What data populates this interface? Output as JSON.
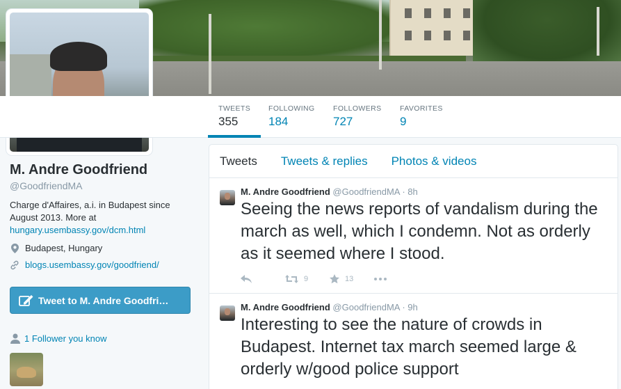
{
  "stats": [
    {
      "label": "TWEETS",
      "value": "355"
    },
    {
      "label": "FOLLOWING",
      "value": "184"
    },
    {
      "label": "FOLLOWERS",
      "value": "727"
    },
    {
      "label": "FAVORITES",
      "value": "9"
    }
  ],
  "profile": {
    "name": "M. Andre Goodfriend",
    "handle": "@GoodfriendMA",
    "bio_text": "Charge d'Affaires, a.i. in Budapest since August 2013. More at",
    "bio_link": "hungary.usembassy.gov/dcm.html",
    "location": "Budapest, Hungary",
    "website": "blogs.usembassy.gov/goodfriend/"
  },
  "tweet_to_button": "Tweet to M. Andre Goodfri…",
  "followers_you_know": "1 Follower you know",
  "timeline_tabs": [
    "Tweets",
    "Tweets & replies",
    "Photos & videos"
  ],
  "tweets": [
    {
      "name": "M. Andre Goodfriend",
      "handle": "@GoodfriendMA",
      "time": "· 8h",
      "text": "Seeing the news reports of vandalism during the march as well, which I condemn.  Not as orderly as it seemed where I stood.",
      "retweets": "9",
      "favorites": "13"
    },
    {
      "name": "M. Andre Goodfriend",
      "handle": "@GoodfriendMA",
      "time": "· 9h",
      "text": "Interesting to see the nature of crowds in Budapest. Internet tax march seemed large & orderly w/good police support",
      "retweets": "",
      "favorites": ""
    }
  ],
  "colors": {
    "accent": "#0084b4",
    "button": "#3c9cc7",
    "background": "#f5f8fa"
  }
}
